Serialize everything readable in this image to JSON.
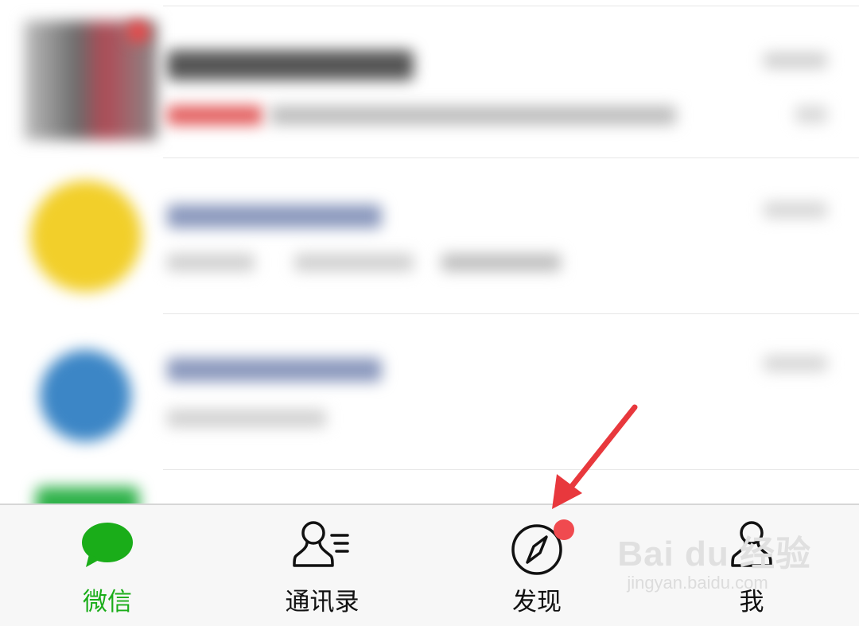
{
  "tabbar": {
    "tabs": [
      {
        "label": "微信",
        "icon": "chat-bubble-icon",
        "active": true
      },
      {
        "label": "通讯录",
        "icon": "contacts-icon",
        "active": false
      },
      {
        "label": "发现",
        "icon": "compass-icon",
        "active": false,
        "badge": "red-dot"
      },
      {
        "label": "我",
        "icon": "person-icon",
        "active": false
      }
    ]
  },
  "watermark": {
    "logo": "Bai du 经验",
    "sub": "jingyan.baidu.com"
  },
  "colors": {
    "active": "#1aad19",
    "badge": "#f04a4f",
    "arrow": "#e8383d",
    "tabbar_bg": "#f7f7f7"
  }
}
